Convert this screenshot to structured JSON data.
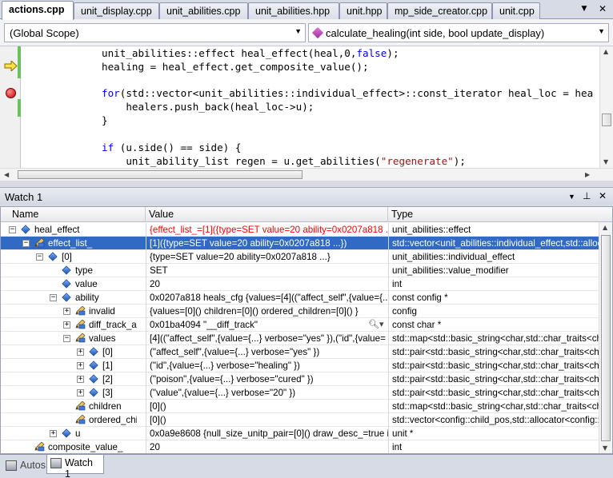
{
  "editor_tabs": [
    "actions.cpp",
    "unit_display.cpp",
    "unit_abilities.cpp",
    "unit_abilities.hpp",
    "unit.hpp",
    "mp_side_creator.cpp",
    "unit.cpp"
  ],
  "tab_controls": {
    "dropdown": "▼",
    "close": "✕"
  },
  "scope": {
    "left": "(Global Scope)",
    "right": "calculate_healing(int side, bool update_display)"
  },
  "code_lines": [
    [
      {
        "t": "            unit_abilities::effect heal_effect(heal,0,"
      },
      {
        "t": "false",
        "c": "kw"
      },
      {
        "t": ");"
      }
    ],
    [
      {
        "t": "            healing = heal_effect.get_composite_value();"
      }
    ],
    [
      {
        "t": ""
      }
    ],
    [
      {
        "t": "            "
      },
      {
        "t": "for",
        "c": "kw"
      },
      {
        "t": "(std::vector<unit_abilities::individual_effect>::const_iterator heal_loc = heal_"
      }
    ],
    [
      {
        "t": "                healers.push_back(heal_loc->u);"
      }
    ],
    [
      {
        "t": "            }"
      }
    ],
    [
      {
        "t": ""
      }
    ],
    [
      {
        "t": "            "
      },
      {
        "t": "if",
        "c": "kw"
      },
      {
        "t": " (u.side() == side) {"
      }
    ],
    [
      {
        "t": "                unit_ability_list regen = u.get_abilities("
      },
      {
        "t": "\"regenerate\"",
        "c": "str"
      },
      {
        "t": ");"
      }
    ]
  ],
  "watch": {
    "title": "Watch 1",
    "controls": {
      "dropdown": "▼",
      "pin": "⊥",
      "close": "✕"
    },
    "columns": [
      "Name",
      "Value",
      "Type"
    ],
    "rows": [
      {
        "name": "heal_effect",
        "value": "{effect_list_=[1]({type=SET value=20 ability=0x0207a818 ...",
        "type": "unit_abilities::effect",
        "depth": 0,
        "exp": "-",
        "icon": "diamond",
        "vred": true
      },
      {
        "name": "effect_list_",
        "value": "[1]({type=SET value=20 ability=0x0207a818 ...})",
        "type": "std::vector<unit_abilities::individual_effect,std::allocator",
        "depth": 1,
        "exp": "-",
        "icon": "pencil",
        "sel": true
      },
      {
        "name": "[0]",
        "value": "{type=SET value=20 ability=0x0207a818 ...}",
        "type": "unit_abilities::individual_effect",
        "depth": 2,
        "exp": "-",
        "icon": "diamond"
      },
      {
        "name": "type",
        "value": "SET",
        "type": "unit_abilities::value_modifier",
        "depth": 3,
        "exp": "",
        "icon": "diamond"
      },
      {
        "name": "value",
        "value": "20",
        "type": "int",
        "depth": 3,
        "exp": "",
        "icon": "diamond"
      },
      {
        "name": "ability",
        "value": "0x0207a818 heals_cfg {values=[4]((\"affect_self\",{value={...}",
        "type": "const config *",
        "depth": 3,
        "exp": "-",
        "icon": "diamond"
      },
      {
        "name": "invalid",
        "value": "{values=[0]() children=[0]() ordered_children=[0]() }",
        "type": "config",
        "depth": 4,
        "exp": "+",
        "icon": "pencil"
      },
      {
        "name": "diff_track_attr",
        "value": "0x01ba4094 \"__diff_track\"",
        "type": "const char *",
        "depth": 4,
        "exp": "+",
        "icon": "pencil",
        "mag": true
      },
      {
        "name": "values",
        "value": "[4]((\"affect_self\",{value={...} verbose=\"yes\" }),(\"id\",{value=",
        "type": "std::map<std::basic_string<char,std::char_traits<ch",
        "depth": 4,
        "exp": "-",
        "icon": "pencil"
      },
      {
        "name": "[0]",
        "value": "(\"affect_self\",{value={...} verbose=\"yes\" })",
        "type": "std::pair<std::basic_string<char,std::char_traits<ch",
        "depth": 5,
        "exp": "+",
        "icon": "diamond"
      },
      {
        "name": "[1]",
        "value": "(\"id\",{value={...} verbose=\"healing\" })",
        "type": "std::pair<std::basic_string<char,std::char_traits<ch",
        "depth": 5,
        "exp": "+",
        "icon": "diamond"
      },
      {
        "name": "[2]",
        "value": "(\"poison\",{value={...} verbose=\"cured\" })",
        "type": "std::pair<std::basic_string<char,std::char_traits<ch",
        "depth": 5,
        "exp": "+",
        "icon": "diamond"
      },
      {
        "name": "[3]",
        "value": "(\"value\",{value={...} verbose=\"20\" })",
        "type": "std::pair<std::basic_string<char,std::char_traits<ch",
        "depth": 5,
        "exp": "+",
        "icon": "diamond"
      },
      {
        "name": "children",
        "value": "[0]()",
        "type": "std::map<std::basic_string<char,std::char_traits<ch",
        "depth": 4,
        "exp": "",
        "icon": "pencil"
      },
      {
        "name": "ordered_children",
        "value": "[0]()",
        "type": "std::vector<config::child_pos,std::allocator<config::c",
        "depth": 4,
        "exp": "",
        "icon": "pencil"
      },
      {
        "name": "u",
        "value": "0x0a9e8608 {null_size_unitp_pair=[0]() draw_desc_=true ign",
        "type": "unit *",
        "depth": 3,
        "exp": "+",
        "icon": "diamond"
      },
      {
        "name": "composite_value_",
        "value": "20",
        "type": "int",
        "depth": 1,
        "exp": "",
        "icon": "pencil"
      }
    ]
  },
  "bottom_tabs": [
    "Autos",
    "Watch 1"
  ]
}
